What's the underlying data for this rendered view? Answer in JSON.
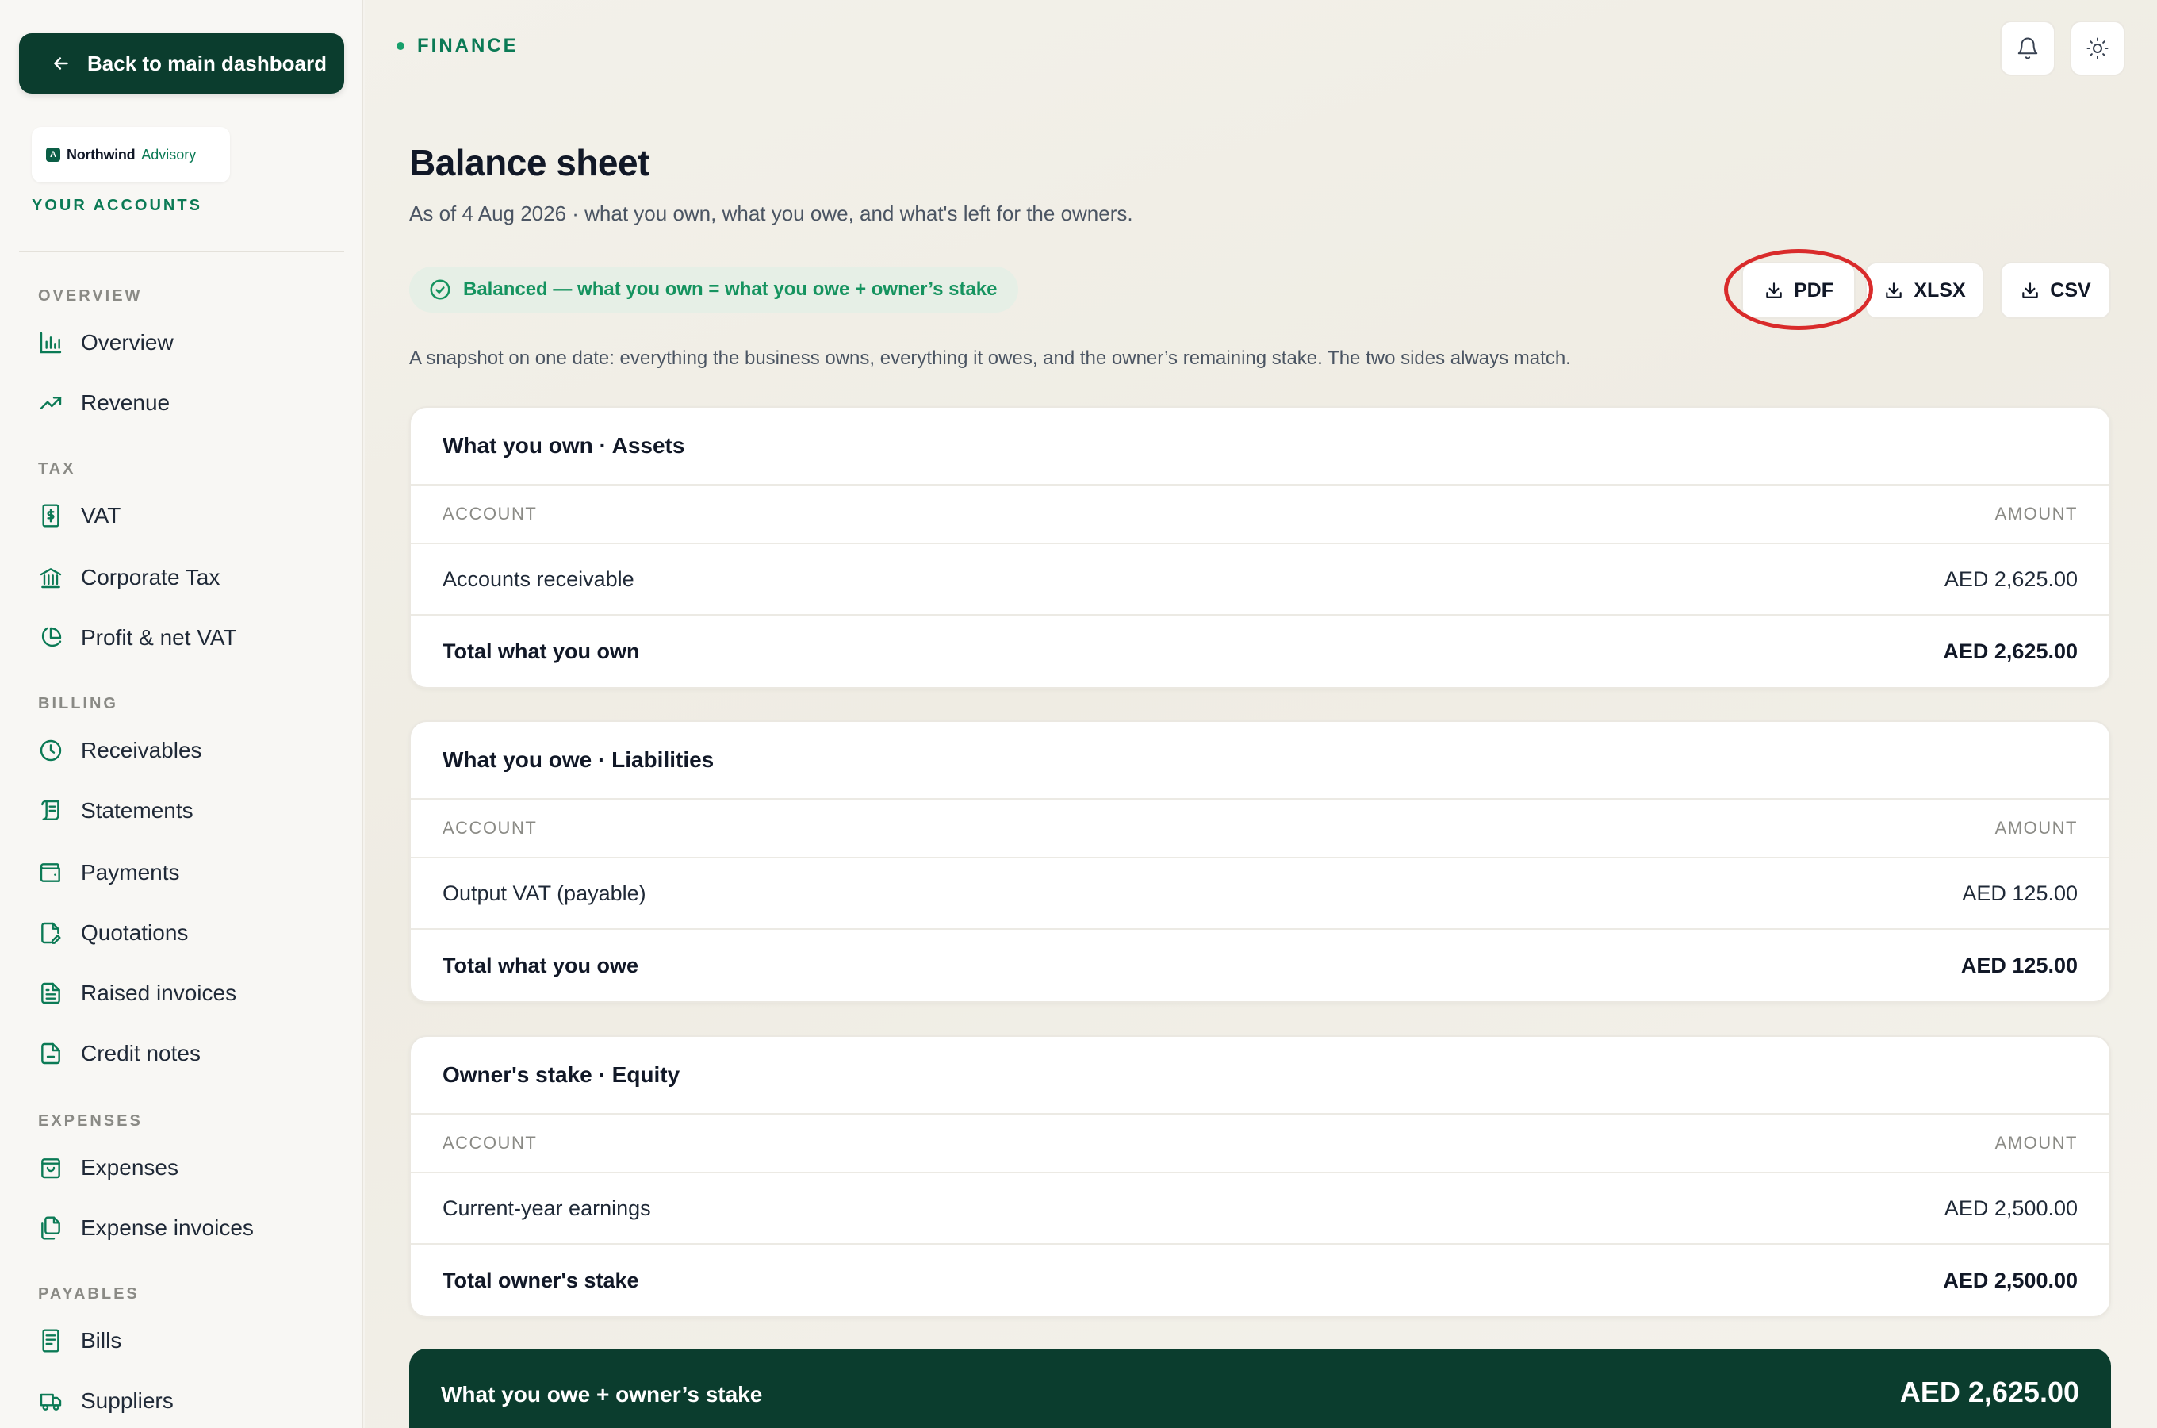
{
  "sidebar": {
    "back_label": "Back to main dashboard",
    "logo": {
      "mark": "A",
      "name": "Northwind",
      "sub": "Advisory"
    },
    "accounts_label": "YOUR ACCOUNTS",
    "sections": {
      "overview": "OVERVIEW",
      "tax": "TAX",
      "billing": "BILLING",
      "expenses": "EXPENSES",
      "payables": "PAYABLES"
    },
    "items": {
      "overview": "Overview",
      "revenue": "Revenue",
      "vat": "VAT",
      "corporate_tax": "Corporate Tax",
      "profit_net_vat": "Profit & net VAT",
      "receivables": "Receivables",
      "statements": "Statements",
      "payments": "Payments",
      "quotations": "Quotations",
      "raised_invoices": "Raised invoices",
      "credit_notes": "Credit notes",
      "expenses": "Expenses",
      "expense_invoices": "Expense invoices",
      "bills": "Bills",
      "suppliers": "Suppliers"
    }
  },
  "header": {
    "crumb": "FINANCE",
    "title": "Balance sheet",
    "subtitle": "As of 4 Aug 2026 · what you own, what you owe, and what's left for the owners.",
    "balanced": "Balanced — what you own = what you owe + owner’s stake",
    "exports": {
      "pdf": "PDF",
      "xlsx": "XLSX",
      "csv": "CSV"
    },
    "intro": "A snapshot on one date: everything the business owns, everything it owes, and the owner’s remaining stake. The two sides always match."
  },
  "assets": {
    "title": "What you own · Assets",
    "col_account": "ACCOUNT",
    "col_amount": "AMOUNT",
    "rows": [
      {
        "account": "Accounts receivable",
        "amount": "AED 2,625.00"
      }
    ],
    "total_label": "Total what you own",
    "total_amount": "AED 2,625.00"
  },
  "liabilities": {
    "title": "What you owe · Liabilities",
    "col_account": "ACCOUNT",
    "col_amount": "AMOUNT",
    "rows": [
      {
        "account": "Output VAT (payable)",
        "amount": "AED 125.00"
      }
    ],
    "total_label": "Total what you owe",
    "total_amount": "AED 125.00"
  },
  "equity": {
    "title": "Owner's stake · Equity",
    "col_account": "ACCOUNT",
    "col_amount": "AMOUNT",
    "rows": [
      {
        "account": "Current-year earnings",
        "amount": "AED 2,500.00"
      }
    ],
    "total_label": "Total owner's stake",
    "total_amount": "AED 2,500.00"
  },
  "footer": {
    "label": "What you owe + owner’s stake",
    "value": "AED 2,625.00"
  },
  "colors": {
    "brand_dark": "#0b3d2e",
    "accent_green": "#0b7a55",
    "highlight_red": "#d92b2b"
  }
}
